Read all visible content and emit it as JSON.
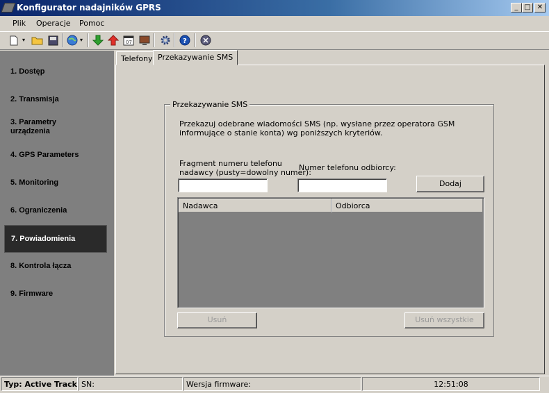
{
  "window": {
    "title": "Konfigurator nadajników GPRS",
    "minimize": "_",
    "maximize": "□",
    "close": "✕"
  },
  "menu": {
    "items": [
      "Plik",
      "Operacje",
      "Pomoc"
    ]
  },
  "toolbar": {
    "icons": [
      "new-file-icon",
      "dropdown-arrow-icon",
      "open-folder-icon",
      "save-icon",
      "globe-icon",
      "dropdown-arrow-icon",
      "download-green-arrow-icon",
      "upload-red-arrow-icon",
      "calendar-icon",
      "monitor-icon",
      "settings-gear-icon",
      "help-icon",
      "exit-icon"
    ]
  },
  "sidebar": {
    "items": [
      {
        "label": "1. Dostęp"
      },
      {
        "label": "2. Transmisja"
      },
      {
        "label": "3. Parametry urządzenia"
      },
      {
        "label": "4. GPS Parameters"
      },
      {
        "label": "5. Monitoring"
      },
      {
        "label": "6. Ograniczenia"
      },
      {
        "label": "7. Powiadomienia"
      },
      {
        "label": "8. Kontrola łącza"
      },
      {
        "label": "9. Firmware"
      }
    ],
    "active_index": 6
  },
  "tabs": [
    {
      "label": "Telefony"
    },
    {
      "label": "Przekazywanie SMS"
    }
  ],
  "active_tab": 1,
  "sms_forwarding": {
    "group_title": "Przekazywanie SMS",
    "description": "Przekazuj odebrane wiadomości SMS (np. wysłane przez operatora GSM informujące o stanie konta) wg poniższych kryteriów.",
    "sender_label_line1": "Fragment numeru telefonu",
    "sender_label_line2": "nadawcy (pusty=dowolny numer):",
    "sender_value": "",
    "recipient_label": "Numer telefonu odbiorcy:",
    "recipient_value": "",
    "add_button": "Dodaj",
    "columns": [
      "Nadawca",
      "Odbiorca"
    ],
    "rows": [],
    "remove_button": "Usuń",
    "remove_all_button": "Usuń wszystkie"
  },
  "statusbar": {
    "type": "Typ: Active Track",
    "sn": "SN:",
    "firmware": "Wersja firmware:",
    "time": "12:51:08"
  },
  "colors": {
    "titlebar_start": "#0a246a",
    "titlebar_end": "#a6caf0",
    "sidebar_bg": "#7f7f7f",
    "active_item_bg": "#2a2a2a"
  }
}
